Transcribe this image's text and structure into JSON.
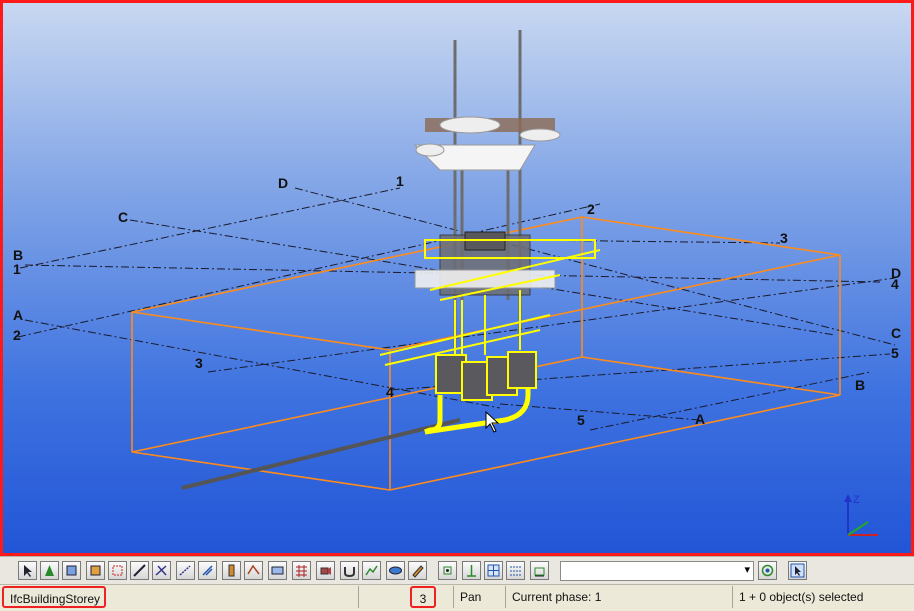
{
  "viewport": {
    "grid_labels": {
      "D_top": "D",
      "one_top": "1",
      "C_left": "C",
      "B_left": "B",
      "one_left": "1",
      "A_left": "A",
      "two_left": "2",
      "two_top": "2",
      "three_top": "3",
      "three_mid": "3",
      "D_right": "D",
      "four_right": "4",
      "C_right": "C",
      "five_right": "5",
      "B_right": "B",
      "four_mid": "4",
      "five_mid": "5",
      "A_right": "A"
    },
    "colors": {
      "border": "#ff1a1a",
      "bounding_box": "#ff8c1a",
      "selection": "#ffff00",
      "background_top": "#c9d8f1",
      "background_bottom": "#2255d6"
    }
  },
  "toolbar": {
    "icons": [
      "select-icon",
      "cone-icon",
      "front-view-icon",
      "box-view-icon",
      "grid-view-icon",
      "plane-icon",
      "cut-plane-icon",
      "measure-icon",
      "column-icon",
      "beam-icon",
      "slab-icon",
      "grid-icon",
      "camera-icon",
      "cup-icon",
      "terrain-icon",
      "surface-icon",
      "pen-icon",
      "snap-end-icon",
      "snap-mid-icon",
      "snap-grid-icon",
      "snap-point-icon",
      "snap-line-icon",
      "view-list-icon",
      "pointer-icon"
    ],
    "view_select_value": ""
  },
  "status": {
    "object_type": "IfcBuildingStorey",
    "count": "3",
    "mode": "Pan",
    "phase": "Current phase: 1",
    "selection": "1 + 0 object(s) selected"
  }
}
